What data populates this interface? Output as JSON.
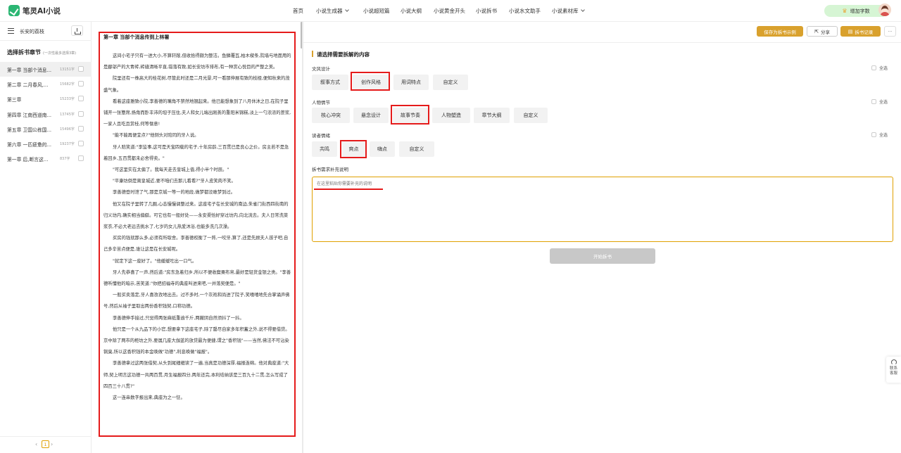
{
  "app": {
    "name": "笔灵AI小说",
    "brand_color": "#2bb673",
    "accent_color": "#d9a12d"
  },
  "nav": [
    {
      "label": "首页",
      "dropdown": false
    },
    {
      "label": "小说生成器",
      "dropdown": true
    },
    {
      "label": "小说超短篇",
      "dropdown": false
    },
    {
      "label": "小说大纲",
      "dropdown": false
    },
    {
      "label": "小说黄金开头",
      "dropdown": false
    },
    {
      "label": "小说拆书",
      "dropdown": false
    },
    {
      "label": "小说水文助手",
      "dropdown": false
    },
    {
      "label": "小说素材库",
      "dropdown": true
    }
  ],
  "header": {
    "add_words_label": "增加字数"
  },
  "left": {
    "book_title": "长安的荔枝",
    "select_title": "选择拆书章节",
    "select_hint": "(一次性最多选择3章)",
    "chapters": [
      {
        "name": "第一章 当部个消息...",
        "words": "13151字",
        "active": true
      },
      {
        "name": "第二章 二月春风,...",
        "words": "15682字",
        "active": false
      },
      {
        "name": "第三章",
        "words": "15233字",
        "active": false
      },
      {
        "name": "第四章 江南西道南...",
        "words": "13745字",
        "active": false
      },
      {
        "name": "第五章 卫国公栋国...",
        "words": "15496字",
        "active": false
      },
      {
        "name": "第六章 一匹疲惫的...",
        "words": "19237字",
        "active": false
      },
      {
        "name": "第一章 后,断言这...",
        "words": "837字",
        "active": false
      }
    ],
    "page": "1"
  },
  "content": {
    "chapter_title": "第一章 当部个消息传到上林署",
    "paragraphs": [
      "这间小宅子只有一进大小,不算轩敞,但收拾得颇为整洁。鱼鳞覆瓦,柏木樑条,院墙与地面用的是郿邬产的大青砖,砖缝清晰平直,错落有致,如长安坊市排布,有一种赏心悦目的严整之美。",
      "院里还有一株高大的桂花树,尽管此时还是二月光景,可一看那伸展有致的枝桠,便知秋来的茂盛气象。",
      "看着这座雅致小院,李善德的嘴角不禁然地翘起来。他已能想象到了八月休沐之日,在院子里铺开一张簟席,扬角而卧丰沛的坦子压住,夫人和女儿端出刚蒸的重阳米锦糕,淡上一勺浓浓的蔗浆,一家人且吃且赏桂,何等惬意!",
      "\"能不能再便宜点?\"他侧头对陪同的牙人说。",
      "牙人赔笑道:\"李监事,这可是天宝四载的宅子,十年房龄,三百贯已是良心之价。房主若不是急着回乡,五百贯都未必舍得卖。\"",
      "\"可这里实在太偏了。我每天走去皇城上值,得小半个时辰。\"",
      "\"平康坊倒是离皇城近,要不咱们去那儿看看?\"牙人皮笑肉不笑。",
      "李善德登时泄了气,那是京城一等一的地段,做梦都没敢梦到过。",
      "他又在院子里转了几圈,心态慢慢调整过来。这座宅子在长安城的南边,朱雀门街西四街南的归义坊内,确实相当偏僻。可它也有一般好处——永安渠恰好穿过坊内,向北流去。夫人日常洗菜浆衣,不必大老远去挑水了,七岁的女儿热爱沐浴,也能多洗几次澡。",
      "买房的钱就那么多,必须有所取舍。李善德权衡了一阵,一咬牙,算了,还是先顾夫人孩子吧,自己多辛苦点便是,谁让这是在长安城呢。",
      "\"就定下这一座好了。\"他缓缓吐出一口气。",
      "牙人先恭喜了一声,然后道:\"房东急着归乡,所以不便收糜粟布帛,最好是轻货金银之类。\"李善德听懂他的暗示,苦笑道:\"你把招福寺的典座叫进来吧,一并落契便是。\"",
      "一般买卖落定,牙人喜孜孜地出去。过不多时,一个灰袍和尚进了院子,笑嘻嘻地先合掌诵声佛号,然后从袖子里取出两份香积钱契,口称功德。",
      "李善德伸手接过,只觉得两张麻纸重逾千斤,两撇阴自然须抖了一抖。",
      "他只是一个从九品下的小官,想要拿下这座宅子,除了罄尽自家多年积蓄之外,说不得要借贷。京中除了两市的柜坊之外,要属几座大伽蓝的放贷最为便捷,谓之\"香积钱\"——当然,佛法不可沾染铜臭,所以这香积钱的本金唤做\"功德\",利息唤做\"福报\"。",
      "李善德拿过这两张借契,从头到尾细细读了一遍,当真是功德深厚,福报连绵。他对典座道:\"大师,契上明言这功德一共两百贯,月生福报四分,两年还完,本利结纳该是三百九十二贯,怎么写成了四百三十八贯?\"",
      "这一连串数字报出来,典座为之一怔。"
    ]
  },
  "right": {
    "btn_demo": "保存为拆书示例",
    "btn_share": "分享",
    "btn_record": "拆书记录",
    "btn_more": "···",
    "section_title": "请选择需要拆解的内容",
    "select_all": "全选",
    "groups": [
      {
        "label": "文风设计",
        "tags": [
          "叙事方式",
          "创作风格",
          "用词特点",
          "自定义"
        ]
      },
      {
        "label": "人物情节",
        "tags": [
          "核心冲突",
          "悬念设计",
          "故事节奏",
          "人物塑造",
          "章节大纲",
          "自定义"
        ]
      },
      {
        "label": "读者情绪",
        "tags": [
          "共鸣",
          "爽点",
          "嗨点",
          "自定义"
        ]
      }
    ],
    "extra_label": "拆书需求补充说明",
    "extra_placeholder": "在这里粘贴你需要补充的说明",
    "start_label": "开始拆书"
  },
  "support": {
    "label1": "联系",
    "label2": "客服"
  }
}
